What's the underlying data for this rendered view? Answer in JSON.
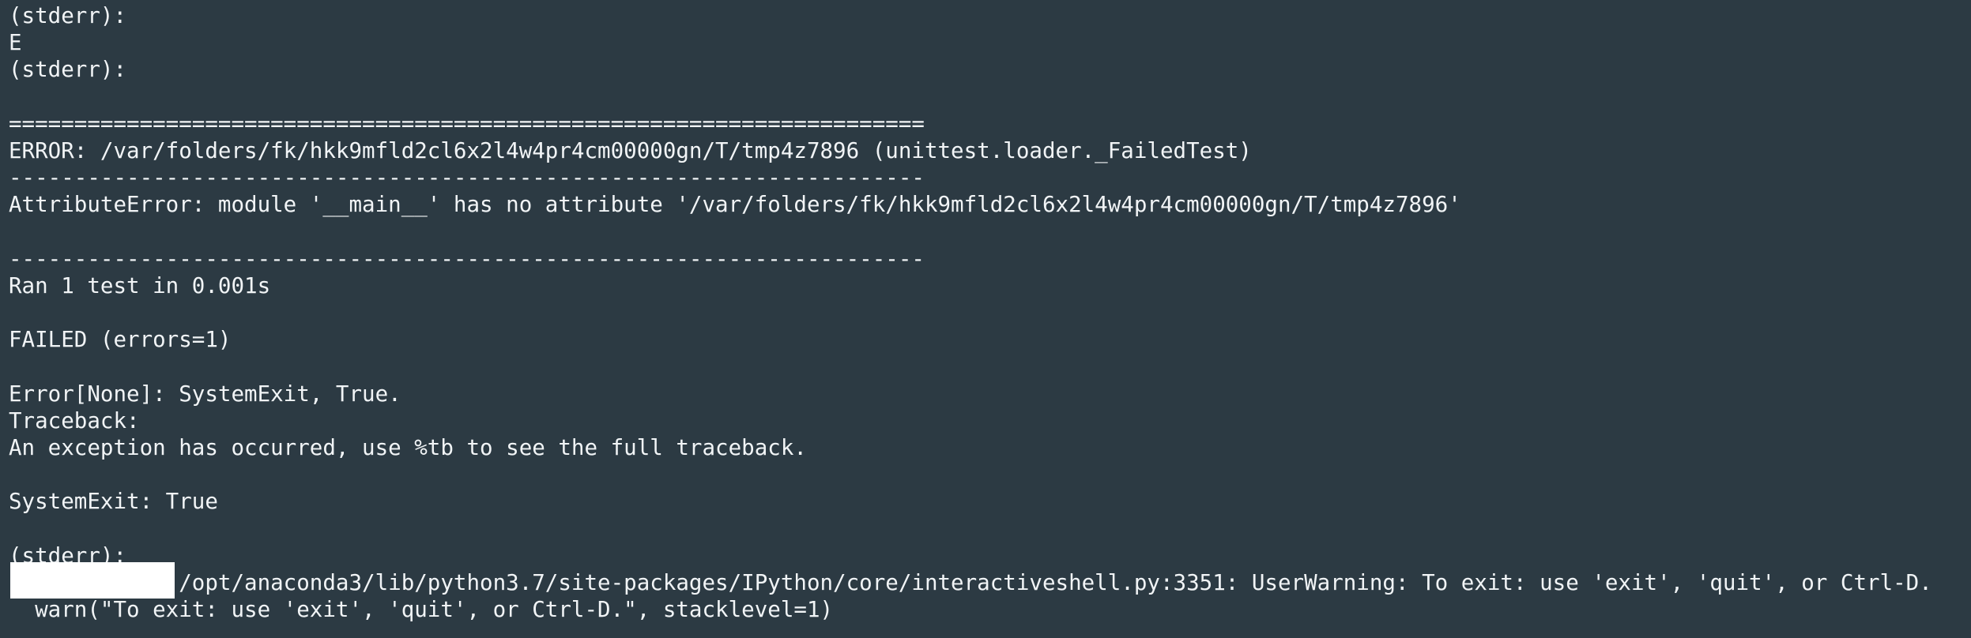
{
  "terminal": {
    "lines": [
      "(stderr):",
      "E",
      "(stderr):",
      "",
      "======================================================================",
      "ERROR: /var/folders/fk/hkk9mfld2cl6x2l4w4pr4cm00000gn/T/tmp4z7896 (unittest.loader._FailedTest)",
      "----------------------------------------------------------------------",
      "AttributeError: module '__main__' has no attribute '/var/folders/fk/hkk9mfld2cl6x2l4w4pr4cm00000gn/T/tmp4z7896'",
      "",
      "----------------------------------------------------------------------",
      "Ran 1 test in 0.001s",
      "",
      "FAILED (errors=1)",
      "",
      "Error[None]: SystemExit, True.",
      "Traceback:",
      "An exception has occurred, use %tb to see the full traceback.",
      "",
      "SystemExit: True",
      "",
      "(stderr):",
      "             /opt/anaconda3/lib/python3.7/site-packages/IPython/core/interactiveshell.py:3351: UserWarning: To exit: use 'exit', 'quit', or Ctrl-D.",
      "  warn(\"To exit: use 'exit', 'quit', or Ctrl-D.\", stacklevel=1)"
    ]
  }
}
